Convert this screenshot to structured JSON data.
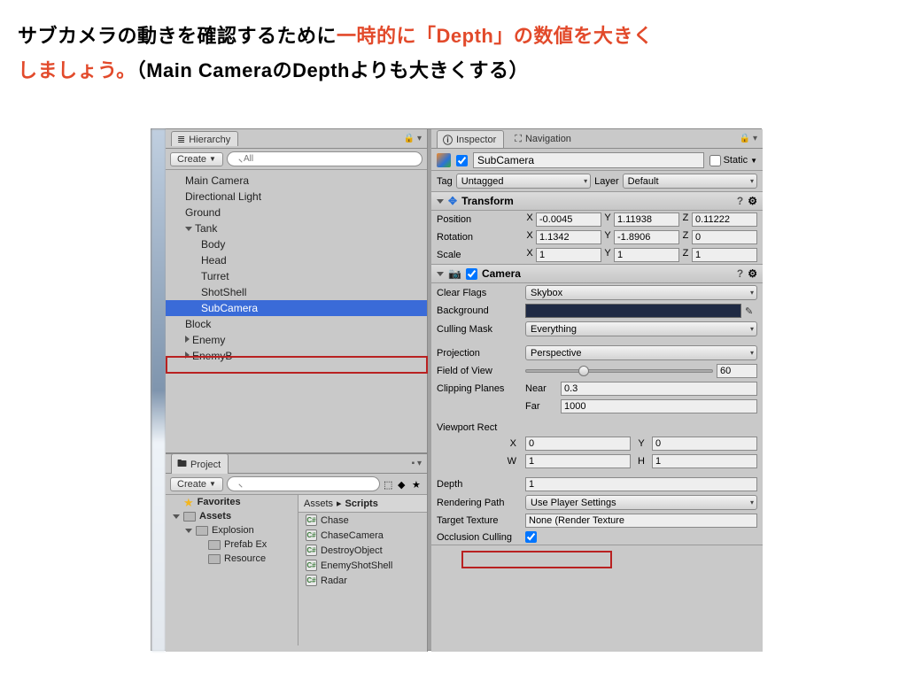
{
  "caption": {
    "p1a": "サブカメラの動きを確認するために",
    "p1b": "一時的に「Depth」の数値を大きく",
    "p2a": "しましょう。",
    "p2b": "（Main CameraのDepthよりも大きくする）"
  },
  "hierarchy": {
    "tab": "Hierarchy",
    "create": "Create",
    "search_ph": "All",
    "items": [
      {
        "label": "Main Camera",
        "depth": 0
      },
      {
        "label": "Directional Light",
        "depth": 0
      },
      {
        "label": "Ground",
        "depth": 0
      },
      {
        "label": "Tank",
        "depth": 0,
        "expand": "down"
      },
      {
        "label": "Body",
        "depth": 1
      },
      {
        "label": "Head",
        "depth": 1
      },
      {
        "label": "Turret",
        "depth": 1
      },
      {
        "label": "ShotShell",
        "depth": 1
      },
      {
        "label": "SubCamera",
        "depth": 1,
        "selected": true
      },
      {
        "label": "Block",
        "depth": 0
      },
      {
        "label": "Enemy",
        "depth": 0,
        "expand": "right"
      },
      {
        "label": "EnemyB",
        "depth": 0,
        "expand": "right"
      }
    ]
  },
  "project": {
    "tab": "Project",
    "create": "Create",
    "crumb_assets": "Assets",
    "crumb_scripts": "Scripts",
    "left": [
      {
        "label": "Favorites",
        "icon": "star",
        "bold": true
      },
      {
        "label": "Assets",
        "icon": "folder",
        "bold": true,
        "expand": "down"
      },
      {
        "label": "Explosion",
        "icon": "folder",
        "depth": 1,
        "expand": "down"
      },
      {
        "label": "Prefab Ex",
        "icon": "folder",
        "depth": 2
      },
      {
        "label": "Resource",
        "icon": "folder",
        "depth": 2
      }
    ],
    "right": [
      "Chase",
      "ChaseCamera",
      "DestroyObject",
      "EnemyShotShell",
      "Radar"
    ]
  },
  "inspector": {
    "tab_inspector": "Inspector",
    "tab_nav": "Navigation",
    "name": "SubCamera",
    "static": "Static",
    "tag_lbl": "Tag",
    "tag_val": "Untagged",
    "layer_lbl": "Layer",
    "layer_val": "Default",
    "transform": {
      "title": "Transform",
      "pos_lbl": "Position",
      "pos": {
        "x": "-0.0045",
        "y": "1.11938",
        "z": "0.11222"
      },
      "rot_lbl": "Rotation",
      "rot": {
        "x": "1.1342",
        "y": "-1.8906",
        "z": "0"
      },
      "scl_lbl": "Scale",
      "scl": {
        "x": "1",
        "y": "1",
        "z": "1"
      }
    },
    "camera": {
      "title": "Camera",
      "clear_lbl": "Clear Flags",
      "clear_val": "Skybox",
      "bg_lbl": "Background",
      "mask_lbl": "Culling Mask",
      "mask_val": "Everything",
      "proj_lbl": "Projection",
      "proj_val": "Perspective",
      "fov_lbl": "Field of View",
      "fov_val": "60",
      "clip_lbl": "Clipping Planes",
      "near_lbl": "Near",
      "near_val": "0.3",
      "far_lbl": "Far",
      "far_val": "1000",
      "vr_lbl": "Viewport Rect",
      "vr_x": "0",
      "vr_y": "0",
      "vr_w": "1",
      "vr_h": "1",
      "depth_lbl": "Depth",
      "depth_val": "1",
      "rp_lbl": "Rendering Path",
      "rp_val": "Use Player Settings",
      "tt_lbl": "Target Texture",
      "tt_val": "None (Render Texture",
      "oc_lbl": "Occlusion Culling"
    }
  }
}
